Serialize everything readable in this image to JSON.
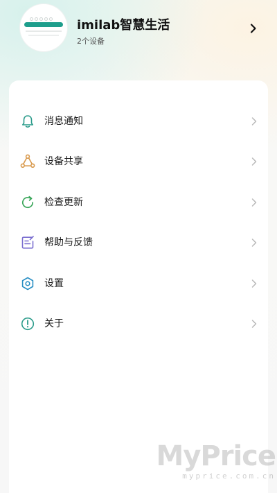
{
  "profile": {
    "app_name": "imilab智慧生活",
    "device_count": "2个设备"
  },
  "menu": {
    "items": [
      {
        "label": "消息通知",
        "icon": "bell-icon"
      },
      {
        "label": "设备共享",
        "icon": "share-icon"
      },
      {
        "label": "检查更新",
        "icon": "refresh-icon"
      },
      {
        "label": "帮助与反馈",
        "icon": "feedback-icon"
      },
      {
        "label": "设置",
        "icon": "settings-icon"
      },
      {
        "label": "关于",
        "icon": "info-icon"
      }
    ]
  },
  "watermark": {
    "brand": "MyPrice",
    "url": "myprice.com.cn"
  },
  "colors": {
    "accent": "#1e9e8c",
    "share_icon": "#d99a4e",
    "icon_teal": "#2a9b8a",
    "chevron": "#b8b8b8"
  }
}
